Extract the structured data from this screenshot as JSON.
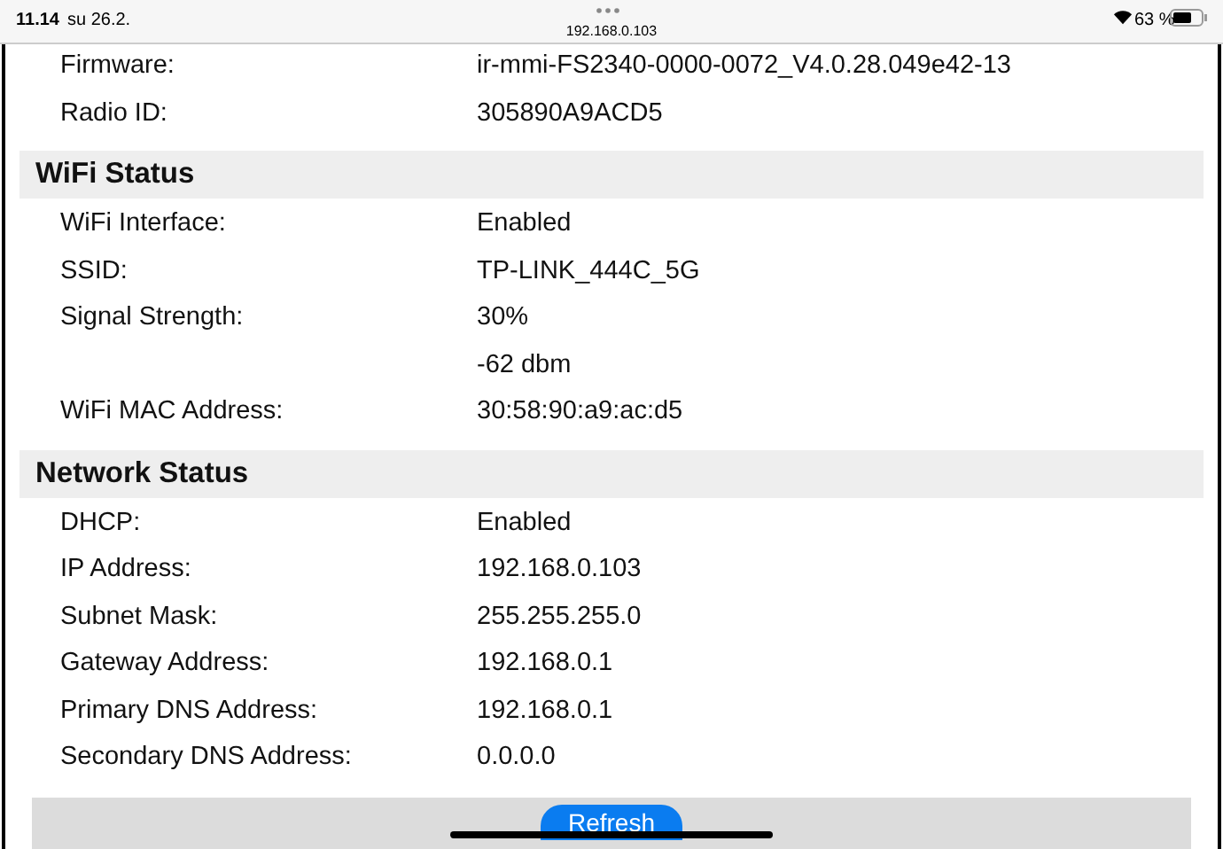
{
  "status_bar": {
    "time": "11.14",
    "date": "su 26.2.",
    "address": "192.168.0.103",
    "battery": "63 %"
  },
  "top_rows": [
    {
      "label": "Firmware:",
      "value": "ir-mmi-FS2340-0000-0072_V4.0.28.049e42-13"
    },
    {
      "label": "Radio ID:",
      "value": "305890A9ACD5"
    }
  ],
  "sections": [
    {
      "title": "WiFi Status",
      "rows": [
        {
          "label": "WiFi Interface:",
          "value": "Enabled"
        },
        {
          "label": "SSID:",
          "value": "TP-LINK_444C_5G"
        },
        {
          "label": "Signal Strength:",
          "value": "30%"
        },
        {
          "value": "-62 dbm"
        },
        {
          "label": "WiFi MAC Address:",
          "value": "30:58:90:a9:ac:d5"
        }
      ]
    },
    {
      "title": "Network Status",
      "rows": [
        {
          "label": "DHCP:",
          "value": "Enabled"
        },
        {
          "label": "IP Address:",
          "value": "192.168.0.103"
        },
        {
          "label": "Subnet Mask:",
          "value": "255.255.255.0"
        },
        {
          "label": "Gateway Address:",
          "value": "192.168.0.1"
        },
        {
          "label": "Primary DNS Address:",
          "value": "192.168.0.1"
        },
        {
          "label": "Secondary DNS Address:",
          "value": "0.0.0.0"
        }
      ]
    }
  ],
  "refresh_button": "Refresh"
}
